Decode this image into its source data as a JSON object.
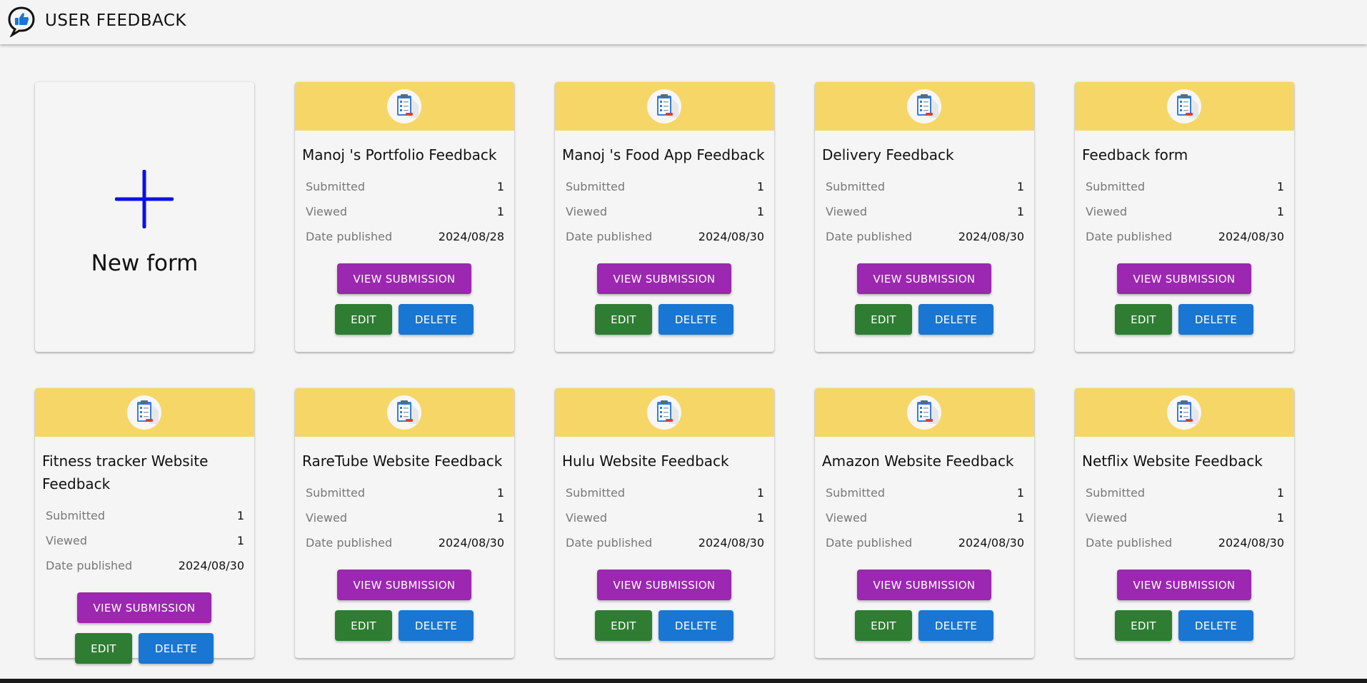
{
  "app": {
    "title": "USER FEEDBACK",
    "logo_icon": "thumbs-up-chat-icon"
  },
  "new_form": {
    "label": "New form",
    "icon": "plus-icon",
    "icon_color": "#0a10e8"
  },
  "labels": {
    "submitted": "Submitted",
    "viewed": "Viewed",
    "date_published": "Date published",
    "view_submission": "VIEW SUBMISSION",
    "edit": "EDIT",
    "delete": "DELETE"
  },
  "colors": {
    "header": "#f6d667",
    "view_button": "#9c27b0",
    "edit_button": "#2e7d32",
    "delete_button": "#1976d2"
  },
  "forms": [
    {
      "title": "Manoj 's Portfolio Feedback",
      "submitted": "1",
      "viewed": "1",
      "date_published": "2024/08/28"
    },
    {
      "title": "Manoj 's Food App Feedback",
      "submitted": "1",
      "viewed": "1",
      "date_published": "2024/08/30"
    },
    {
      "title": "Delivery Feedback",
      "submitted": "1",
      "viewed": "1",
      "date_published": "2024/08/30"
    },
    {
      "title": "Feedback form",
      "submitted": "1",
      "viewed": "1",
      "date_published": "2024/08/30"
    },
    {
      "title": "Fitness tracker Website Feedback",
      "submitted": "1",
      "viewed": "1",
      "date_published": "2024/08/30"
    },
    {
      "title": "RareTube Website Feedback",
      "submitted": "1",
      "viewed": "1",
      "date_published": "2024/08/30"
    },
    {
      "title": "Hulu Website Feedback",
      "submitted": "1",
      "viewed": "1",
      "date_published": "2024/08/30"
    },
    {
      "title": "Amazon Website Feedback",
      "submitted": "1",
      "viewed": "1",
      "date_published": "2024/08/30"
    },
    {
      "title": "Netflix Website Feedback",
      "submitted": "1",
      "viewed": "1",
      "date_published": "2024/08/30"
    }
  ]
}
